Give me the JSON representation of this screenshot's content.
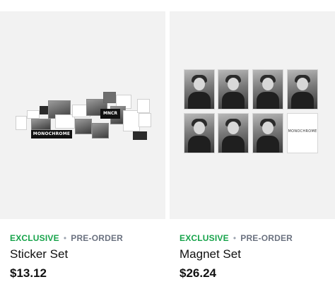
{
  "products": [
    {
      "tag_exclusive": "EXCLUSIVE",
      "tag_separator": "•",
      "tag_preorder": "PRE-ORDER",
      "name": "Sticker Set",
      "price": "$13.12",
      "image_text": {
        "mono": "MONOCHROME",
        "mncr": "MNCR"
      }
    },
    {
      "tag_exclusive": "EXCLUSIVE",
      "tag_separator": "•",
      "tag_preorder": "PRE-ORDER",
      "name": "Magnet Set",
      "price": "$26.24",
      "image_text": {
        "cover": "MONOCHROME"
      }
    }
  ],
  "colors": {
    "exclusive": "#16a34a",
    "preorder": "#6b7280",
    "image_bg": "#f2f2f2"
  }
}
